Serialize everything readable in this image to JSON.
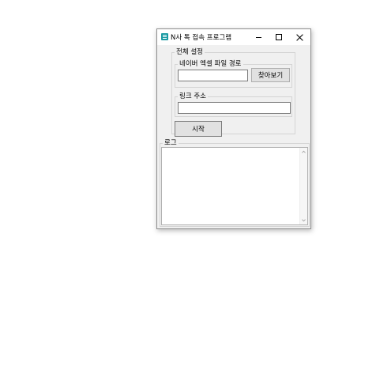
{
  "window": {
    "title": "N사 톡 접속 프로그램",
    "icon": "app-icon",
    "controls": [
      "minimize-icon",
      "maximize-icon",
      "close-icon"
    ]
  },
  "settings": {
    "group_label": "전체 설정",
    "excel": {
      "group_label": "네이버 엑셀 파일 경로",
      "path_value": "",
      "browse_label": "찾아보기"
    },
    "link": {
      "group_label": "링크 주소",
      "value": ""
    },
    "start_label": "시작"
  },
  "log": {
    "group_label": "로그",
    "content": ""
  },
  "colors": {
    "app_icon": "#1a9aa3",
    "window_bg": "#f0f0f0",
    "titlebar_bg": "#ffffff"
  }
}
